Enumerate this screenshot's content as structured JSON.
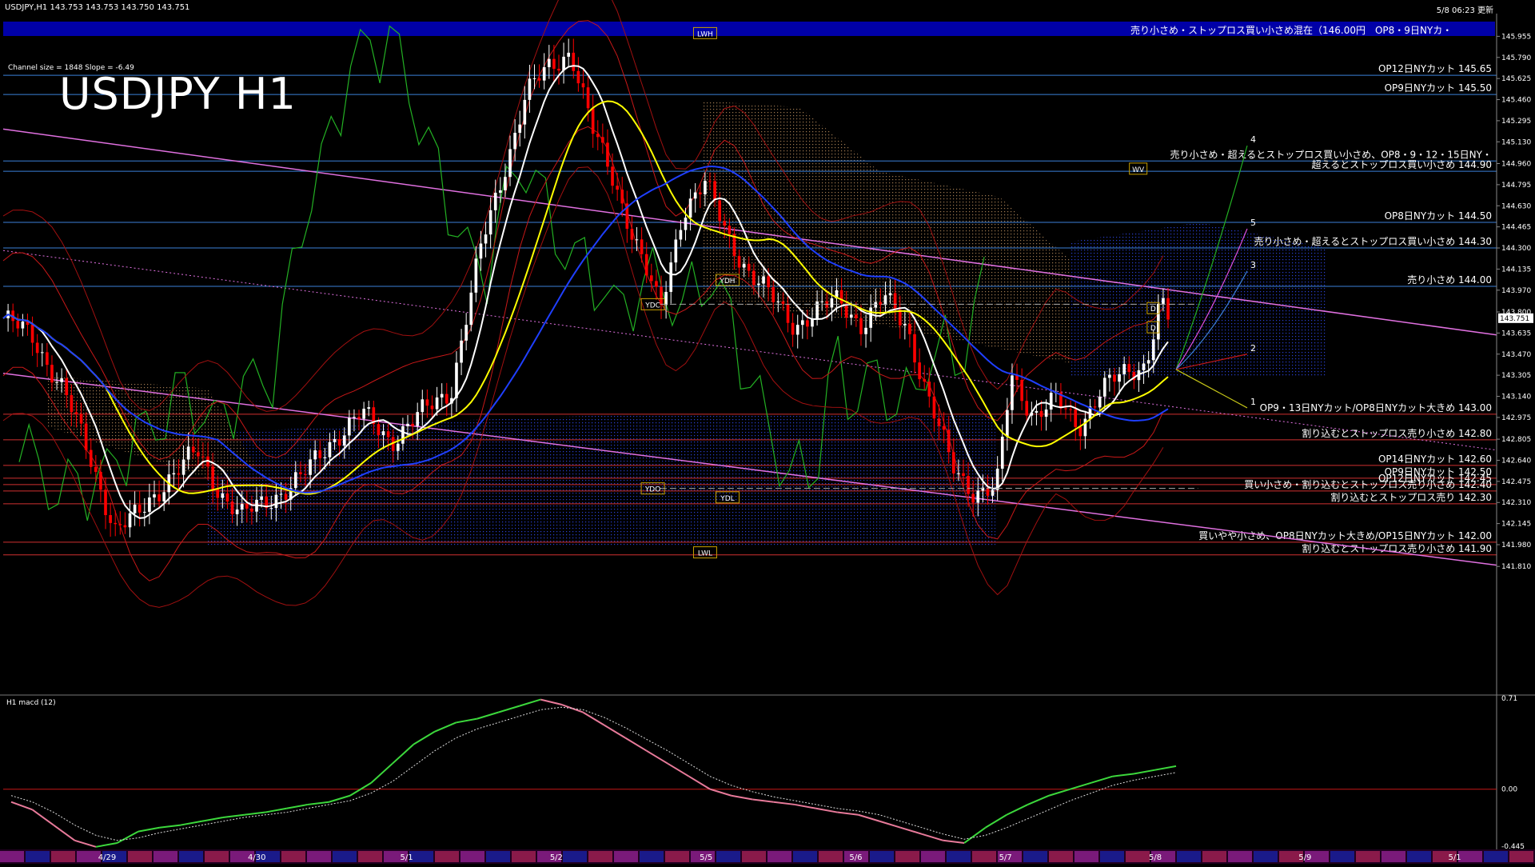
{
  "header": {
    "symbol_info": "USDJPY,H1  143.753 143.753 143.750 143.751",
    "updated": "5/8 06:23 更新"
  },
  "title": "USDJPY H1",
  "channel_info": "Channel size = 1848 Slope = -6.49",
  "chart_data": {
    "type": "candlestick",
    "title": "USDJPY H1",
    "ylim": [
      141.83,
      146.07
    ],
    "price_ticks": [
      "145.955",
      "145.790",
      "145.625",
      "145.460",
      "145.295",
      "145.130",
      "144.960",
      "144.795",
      "144.630",
      "144.465",
      "144.300",
      "144.135",
      "143.970",
      "143.800",
      "143.635",
      "143.470",
      "143.305",
      "143.140",
      "142.975",
      "142.805",
      "142.640",
      "142.475",
      "142.310",
      "142.145",
      "141.980",
      "141.810"
    ],
    "current_price": "143.751",
    "levels": [
      {
        "price": 145.65,
        "label": "OP12日NYカット 145.65",
        "color": "#3b7fd8",
        "text_color": "#ffffff"
      },
      {
        "price": 145.5,
        "label": "OP9日NYカット 145.50",
        "color": "#3b7fd8",
        "text_color": "#ffffff"
      },
      {
        "price": 144.98,
        "label": "売り小さめ・超えるとストップロス買い小さめ、OP8・9・12・15日NY・",
        "color": "#3b7fd8",
        "text_color": "#ffffff"
      },
      {
        "price": 144.9,
        "label": "超えるとストップロス買い小さめ 144.90",
        "color": "#3b7fd8",
        "text_color": "#ffffff"
      },
      {
        "price": 144.5,
        "label": "OP8日NYカット 144.50",
        "color": "#3b7fd8",
        "text_color": "#ffffff"
      },
      {
        "price": 144.3,
        "label": "売り小さめ・超えるとストップロス買い小さめ 144.30",
        "color": "#3b7fd8",
        "text_color": "#ffffff"
      },
      {
        "price": 144.0,
        "label": "売り小さめ 144.00",
        "color": "#3b7fd8",
        "text_color": "#ffffff"
      },
      {
        "price": 143.0,
        "label": "OP9・13日NYカット/OP8日NYカット大きめ 143.00",
        "color": "#d03030",
        "text_color": "#ffffff"
      },
      {
        "price": 142.8,
        "label": "割り込むとストップロス売り小さめ 142.80",
        "color": "#d03030",
        "text_color": "#ffffff"
      },
      {
        "price": 142.6,
        "label": "OP14日NYカット 142.60",
        "color": "#d03030",
        "text_color": "#ffffff"
      },
      {
        "price": 142.5,
        "label": "OP9日NYカット 142.50",
        "color": "#d03030",
        "text_color": "#ffffff"
      },
      {
        "price": 142.45,
        "label": "OP12日NYカット 142.45",
        "color": "#d03030",
        "text_color": "#ffffff"
      },
      {
        "price": 142.4,
        "label": "買い小さめ・割り込むとストップロス売り小さめ 142.40",
        "color": "#d03030",
        "text_color": "#ffffff"
      },
      {
        "price": 142.3,
        "label": "割り込むとストップロス売り 142.30",
        "color": "#d03030",
        "text_color": "#ffffff"
      },
      {
        "price": 142.0,
        "label": "買いやや小さめ、OP8日NYカット大きめ/OP15日NYカット 142.00",
        "color": "#d03030",
        "text_color": "#ffffff"
      },
      {
        "price": 141.9,
        "label": "割り込むとストップロス売り小さめ 141.90",
        "color": "#d03030",
        "text_color": "#ffffff"
      }
    ],
    "top_banner": "売り小さめ・ストップロス買い小さめ混在（146.00円　OP8・9日NYカ・",
    "markers": [
      {
        "label": "LWH",
        "x": 0.47,
        "price": 145.98
      },
      {
        "label": "YDH",
        "x": 0.485,
        "price": 144.05
      },
      {
        "label": "YDC",
        "x": 0.435,
        "price": 143.86
      },
      {
        "label": "YDO",
        "x": 0.435,
        "price": 142.42
      },
      {
        "label": "YDL",
        "x": 0.485,
        "price": 142.35
      },
      {
        "label": "LWL",
        "x": 0.47,
        "price": 141.92
      },
      {
        "label": "WV",
        "x": 0.76,
        "price": 144.92
      },
      {
        "label": "D",
        "x": 0.77,
        "price": 143.83
      },
      {
        "label": "D",
        "x": 0.77,
        "price": 143.68
      }
    ],
    "projection_labels": [
      "4",
      "5",
      "3",
      "2",
      "1"
    ],
    "x_labels": [
      "4/29",
      "4/30",
      "5/1",
      "5/2",
      "5/5",
      "5/6",
      "5/7",
      "5/8",
      "5/9",
      "5/1"
    ],
    "macd": {
      "label": "H1  macd (12)",
      "ticks": [
        "0.71",
        "0.00",
        "-0.445"
      ],
      "ylim": [
        -0.445,
        0.71
      ],
      "values": [
        -0.1,
        -0.16,
        -0.28,
        -0.4,
        -0.45,
        -0.42,
        -0.33,
        -0.3,
        -0.28,
        -0.25,
        -0.22,
        -0.2,
        -0.18,
        -0.15,
        -0.12,
        -0.1,
        -0.05,
        0.05,
        0.2,
        0.35,
        0.45,
        0.52,
        0.55,
        0.6,
        0.65,
        0.7,
        0.66,
        0.6,
        0.5,
        0.4,
        0.3,
        0.2,
        0.1,
        0.0,
        -0.05,
        -0.08,
        -0.1,
        -0.12,
        -0.15,
        -0.18,
        -0.2,
        -0.25,
        -0.3,
        -0.35,
        -0.4,
        -0.42,
        -0.3,
        -0.2,
        -0.12,
        -0.05,
        0.0,
        0.05,
        0.1,
        0.12,
        0.15,
        0.18
      ],
      "signal": [
        -0.05,
        -0.1,
        -0.18,
        -0.28,
        -0.36,
        -0.4,
        -0.38,
        -0.34,
        -0.31,
        -0.28,
        -0.25,
        -0.22,
        -0.2,
        -0.18,
        -0.15,
        -0.12,
        -0.09,
        -0.03,
        0.06,
        0.18,
        0.3,
        0.4,
        0.47,
        0.52,
        0.57,
        0.62,
        0.64,
        0.62,
        0.56,
        0.48,
        0.39,
        0.3,
        0.2,
        0.1,
        0.03,
        -0.02,
        -0.06,
        -0.09,
        -0.12,
        -0.15,
        -0.17,
        -0.2,
        -0.25,
        -0.3,
        -0.35,
        -0.39,
        -0.36,
        -0.3,
        -0.23,
        -0.16,
        -0.09,
        -0.03,
        0.03,
        0.07,
        0.1,
        0.13
      ]
    }
  },
  "colors": {
    "background": "#000000",
    "bull": "#ffffff",
    "bear": "#ff0000",
    "ma_white": "#ffffff",
    "ma_yellow": "#ffff00",
    "ma_blue": "#1f3fff",
    "chikou": "#23b023",
    "channel": "#e070e0",
    "banner": "#0000a8",
    "macd_up": "#3cd83c",
    "macd_down": "#e87a9a"
  }
}
